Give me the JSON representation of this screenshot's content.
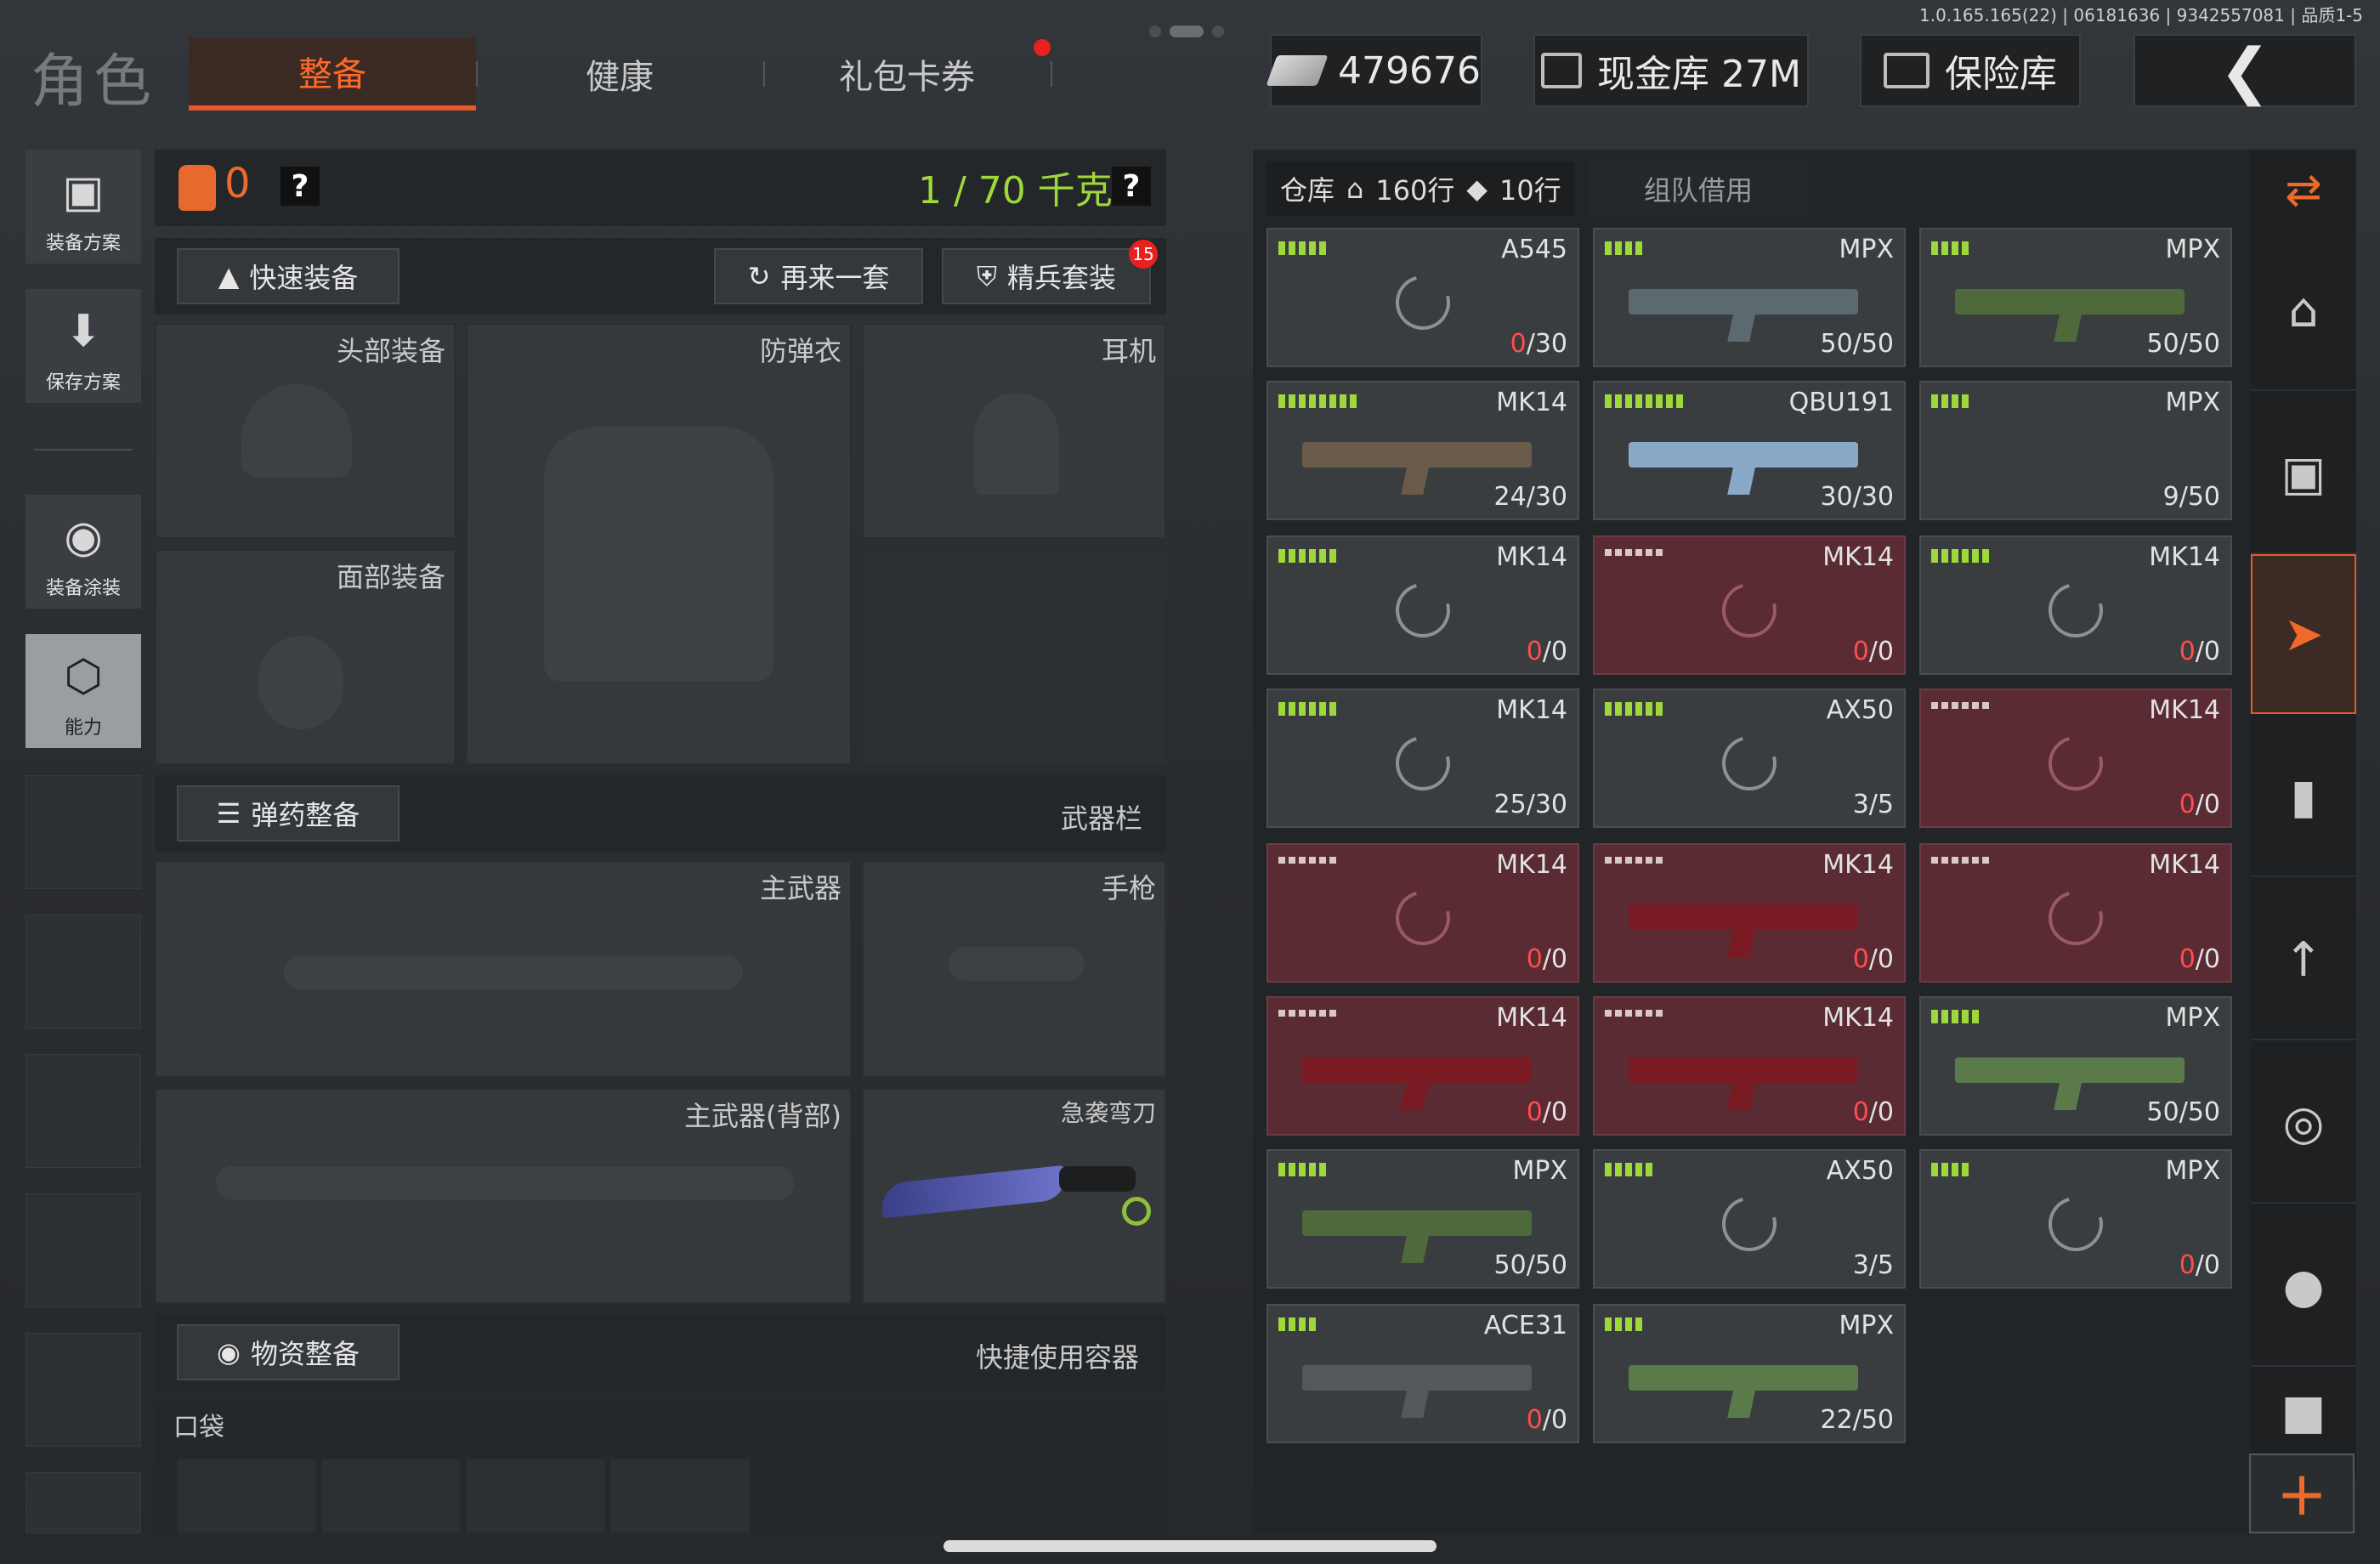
{
  "version": "1.0.165.165(22) | 06181636 | 9342557081 | 品质1-5",
  "header": {
    "role_title": "角色",
    "tabs": [
      {
        "label": "整备",
        "active": true
      },
      {
        "label": "健康",
        "active": false
      },
      {
        "label": "礼包卡券",
        "active": false
      }
    ],
    "currency": "479676",
    "cash_vault": "现金库 27M",
    "safe_box": "保险库"
  },
  "sidebar": {
    "items": [
      "装备方案",
      "保存方案",
      "装备涂装",
      "能力"
    ]
  },
  "loadout": {
    "bag_count": "0",
    "weight": "1 / 70 千克",
    "quick_equip": "快速装备",
    "another_set": "再来一套",
    "elite_set": "精兵套装",
    "elite_badge": "15",
    "slots": {
      "head": "头部装备",
      "armor": "防弹衣",
      "earphone": "耳机",
      "face": "面部装备",
      "primary": "主武器",
      "pistol": "手枪",
      "primary_back": "主武器(背部)",
      "knife": "急袭弯刀"
    },
    "ammo_prep": "弹药整备",
    "weapon_bar": "武器栏",
    "supply_prep": "物资整备",
    "quick_container": "快捷使用容器",
    "pocket": "口袋"
  },
  "warehouse": {
    "tab_label": "仓库",
    "home_rows": "160行",
    "tag_rows": "10行",
    "team_borrow": "组队借用",
    "items": [
      {
        "name": "A545",
        "ammo_cur": "0",
        "ammo_max": "30",
        "cur_red": true,
        "state": "loading",
        "bars": 5,
        "red": false
      },
      {
        "name": "MPX",
        "ammo_cur": "50",
        "ammo_max": "50",
        "cur_red": false,
        "state": "gun",
        "gun_color": "#5a6a6e",
        "bars": 4,
        "red": false
      },
      {
        "name": "MPX",
        "ammo_cur": "50",
        "ammo_max": "50",
        "cur_red": false,
        "state": "gun",
        "gun_color": "#4e6a3a",
        "bars": 4,
        "red": false
      },
      {
        "name": "MK14",
        "ammo_cur": "24",
        "ammo_max": "30",
        "cur_red": false,
        "state": "gun",
        "gun_color": "#6a5a4a",
        "bars": 8,
        "red": false
      },
      {
        "name": "QBU191",
        "ammo_cur": "30",
        "ammo_max": "30",
        "cur_red": false,
        "state": "gun",
        "gun_color": "#8aa8c8",
        "bars": 8,
        "red": false
      },
      {
        "name": "MPX",
        "ammo_cur": "9",
        "ammo_max": "50",
        "cur_red": false,
        "state": "gun",
        "gun_color": "#3a3d40",
        "bars": 4,
        "red": false
      },
      {
        "name": "MK14",
        "ammo_cur": "0",
        "ammo_max": "0",
        "cur_red": true,
        "state": "loading",
        "bars": 6,
        "red": false
      },
      {
        "name": "MK14",
        "ammo_cur": "0",
        "ammo_max": "0",
        "cur_red": true,
        "state": "loading",
        "bars": 6,
        "red": true
      },
      {
        "name": "MK14",
        "ammo_cur": "0",
        "ammo_max": "0",
        "cur_red": true,
        "state": "loading",
        "bars": 6,
        "red": false
      },
      {
        "name": "MK14",
        "ammo_cur": "25",
        "ammo_max": "30",
        "cur_red": false,
        "state": "loading",
        "bars": 6,
        "red": false
      },
      {
        "name": "AX50",
        "ammo_cur": "3",
        "ammo_max": "5",
        "cur_red": false,
        "state": "loading",
        "bars": 6,
        "red": false
      },
      {
        "name": "MK14",
        "ammo_cur": "0",
        "ammo_max": "0",
        "cur_red": true,
        "state": "loading",
        "bars": 6,
        "red": true
      },
      {
        "name": "MK14",
        "ammo_cur": "0",
        "ammo_max": "0",
        "cur_red": true,
        "state": "loading",
        "bars": 6,
        "red": true
      },
      {
        "name": "MK14",
        "ammo_cur": "0",
        "ammo_max": "0",
        "cur_red": true,
        "state": "gun",
        "gun_color": "#7a1a22",
        "bars": 6,
        "red": true
      },
      {
        "name": "MK14",
        "ammo_cur": "0",
        "ammo_max": "0",
        "cur_red": true,
        "state": "loading",
        "bars": 6,
        "red": true
      },
      {
        "name": "MK14",
        "ammo_cur": "0",
        "ammo_max": "0",
        "cur_red": true,
        "state": "gun",
        "gun_color": "#7a1a22",
        "bars": 6,
        "red": true
      },
      {
        "name": "MK14",
        "ammo_cur": "0",
        "ammo_max": "0",
        "cur_red": true,
        "state": "gun",
        "gun_color": "#7a1a22",
        "bars": 6,
        "red": true
      },
      {
        "name": "MPX",
        "ammo_cur": "50",
        "ammo_max": "50",
        "cur_red": false,
        "state": "gun",
        "gun_color": "#5a7a4a",
        "bars": 5,
        "red": false
      },
      {
        "name": "MPX",
        "ammo_cur": "50",
        "ammo_max": "50",
        "cur_red": false,
        "state": "gun",
        "gun_color": "#4e6a3a",
        "bars": 5,
        "red": false
      },
      {
        "name": "AX50",
        "ammo_cur": "3",
        "ammo_max": "5",
        "cur_red": false,
        "state": "loading",
        "bars": 5,
        "red": false
      },
      {
        "name": "MPX",
        "ammo_cur": "0",
        "ammo_max": "0",
        "cur_red": true,
        "state": "loading",
        "bars": 4,
        "red": false
      },
      {
        "name": "ACE31",
        "ammo_cur": "0",
        "ammo_max": "0",
        "cur_red": true,
        "state": "gun",
        "gun_color": "#55585b",
        "bars": 4,
        "red": false
      },
      {
        "name": "MPX",
        "ammo_cur": "22",
        "ammo_max": "50",
        "cur_red": false,
        "state": "gun",
        "gun_color": "#5a7a4a",
        "bars": 4,
        "red": false
      }
    ]
  },
  "colors": {
    "accent": "#e6572a",
    "weight_green": "#9ed83a",
    "empty_red": "#ff4d4d",
    "broken_bg": "#5a2b33"
  }
}
